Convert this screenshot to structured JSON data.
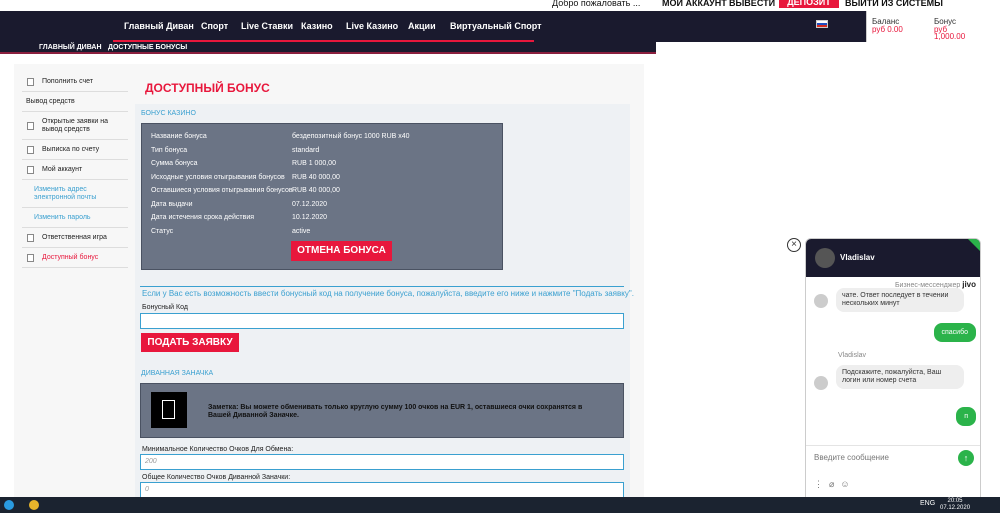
{
  "topbar": {
    "welcome": "Добро пожаловать ...",
    "my_account": "МОЙ АККАУНТ",
    "withdraw": "ВЫВЕСТИ",
    "deposit": "ДЕПОЗИТ",
    "logout": "ВЫЙТИ ИЗ СИСТЕМЫ"
  },
  "nav": {
    "items": [
      "Главный Диван",
      "Спорт",
      "Live Ставки",
      "Казино",
      "Live Казино",
      "Акции",
      "Виртуальный Спорт"
    ]
  },
  "balance": {
    "balance_label": "Баланс",
    "balance_value": "руб 0.00",
    "bonus_label": "Бонус",
    "bonus_value": "руб",
    "bonus_amount": "1,000.00"
  },
  "subnav": [
    "ГЛАВНЫЙ ДИВАН",
    "ДОСТУПНЫЕ БОНУСЫ"
  ],
  "sidebar": [
    {
      "label": "Пополнить счет"
    },
    {
      "label": "Вывод средств"
    },
    {
      "label": "Открытые заявки на вывод средств"
    },
    {
      "label": "Выписка по счету"
    },
    {
      "label": "Мой аккаунт"
    },
    {
      "label": "Изменить адрес электронной почты"
    },
    {
      "label": "Изменить пароль"
    },
    {
      "label": "Ответственная игра"
    },
    {
      "label": "Доступный бонус"
    }
  ],
  "page": {
    "title": "ДОСТУПНЫЙ БОНУС",
    "casino_section": "БОНУС КАЗИНО",
    "bonus_rows": [
      {
        "k": "Название бонуса",
        "v": "бездепозитный бонус 1000 RUB x40"
      },
      {
        "k": "Тип бонуса",
        "v": "standard"
      },
      {
        "k": "Сумма бонуса",
        "v": "RUB 1 000,00"
      },
      {
        "k": "Исходные условия отыгрывания бонусов",
        "v": "RUB 40 000,00"
      },
      {
        "k": "Оставшиеся условия отыгрывания бонусов",
        "v": "RUB 40 000,00"
      },
      {
        "k": "Дата выдачи",
        "v": "07.12.2020"
      },
      {
        "k": "Дата истечения срока действия",
        "v": "10.12.2020"
      },
      {
        "k": "Статус",
        "v": "active"
      }
    ],
    "cancel_bonus": "ОТМЕНА БОНУСА",
    "promo_note": "Если у Вас есть возможность ввести бонусный код на получение бонуса, пожалуйста, введите его ниже и нажмите \"Подать заявку\".",
    "promo_label": "Бонусный Код",
    "submit": "ПОДАТЬ ЗАЯВКУ",
    "sofa_section": "ДИВАННАЯ ЗАНАЧКА",
    "sofa_note": "Заметка: Вы можете обменивать только круглую сумму 100 очков на EUR 1, оставшиеся очки сохранятся в Вашей Диванной Заначке.",
    "min_points_label": "Минимальное Количество Очков Для Обмена:",
    "min_points_value": "200",
    "total_points_label": "Общее Количество Очков Диванной Заначки:",
    "total_points_value": "0"
  },
  "chat": {
    "agent_name": "Vladislav",
    "subtitle": "Бизнес-мессенджер",
    "brand": "jivo",
    "msg1": "чате. Ответ последует в течении нескольких минут",
    "reply1": "спасибо",
    "agent_label": "Vladislav",
    "msg2": "Подскажите, пожалуйста, Ваш логин или номер счета",
    "reply2": "п",
    "input_placeholder": "Введите сообщение",
    "close_icon": "×"
  },
  "taskbar": {
    "lang": "ENG",
    "time": "20:05",
    "date": "07.12.2020"
  },
  "colors": {
    "accent": "#e8173c",
    "nav": "#1a1a2e",
    "link": "#3aa0d0",
    "chat_green": "#2bb34a"
  }
}
